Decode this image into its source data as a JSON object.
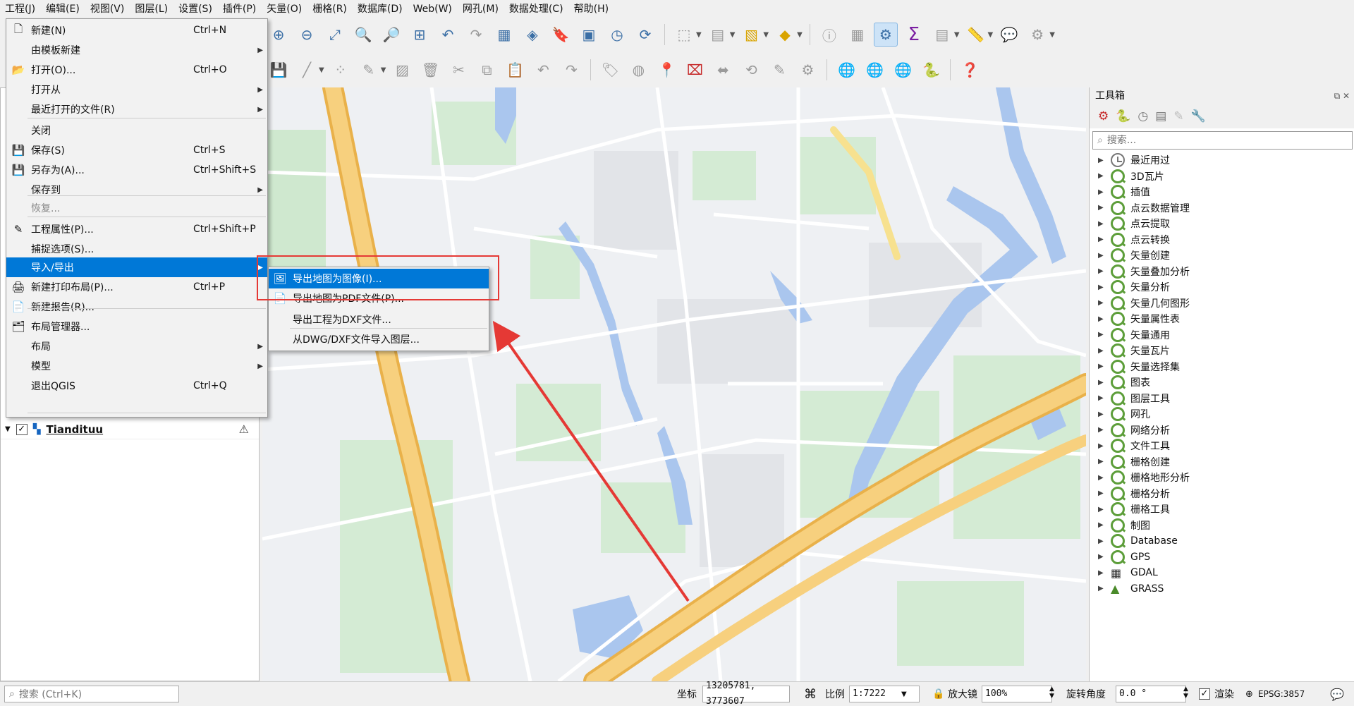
{
  "menubar": [
    {
      "label": "工程(J)",
      "active": true
    },
    {
      "label": "编辑(E)"
    },
    {
      "label": "视图(V)"
    },
    {
      "label": "图层(L)"
    },
    {
      "label": "设置(S)"
    },
    {
      "label": "插件(P)"
    },
    {
      "label": "矢量(O)"
    },
    {
      "label": "栅格(R)"
    },
    {
      "label": "数据库(D)"
    },
    {
      "label": "Web(W)"
    },
    {
      "label": "网孔(M)"
    },
    {
      "label": "数据处理(C)"
    },
    {
      "label": "帮助(H)"
    }
  ],
  "project_menu": {
    "items": [
      {
        "label": "新建(N)",
        "shortcut": "Ctrl+N",
        "icon": "new-file-icon"
      },
      {
        "label": "由模板新建",
        "submenu": true
      },
      {
        "label": "打开(O)...",
        "shortcut": "Ctrl+O",
        "icon": "folder-icon"
      },
      {
        "label": "打开从",
        "submenu": true
      },
      {
        "label": "最近打开的文件(R)",
        "submenu": true
      },
      {
        "label": "关闭"
      },
      {
        "label": "保存(S)",
        "shortcut": "Ctrl+S",
        "icon": "save-icon"
      },
      {
        "label": "另存为(A)...",
        "shortcut": "Ctrl+Shift+S",
        "icon": "save-as-icon"
      },
      {
        "label": "保存到",
        "submenu": true
      },
      {
        "label": "恢复...",
        "disabled": true
      },
      {
        "label": "工程属性(P)...",
        "shortcut": "Ctrl+Shift+P",
        "icon": "pencil-icon"
      },
      {
        "label": "捕捉选项(S)..."
      },
      {
        "label": "导入/导出",
        "submenu": true,
        "selected": true
      },
      {
        "label": "新建打印布局(P)...",
        "shortcut": "Ctrl+P",
        "icon": "print-layout-icon"
      },
      {
        "label": "新建报告(R)...",
        "icon": "report-icon"
      },
      {
        "label": "布局管理器...",
        "icon": "layout-manager-icon"
      },
      {
        "label": "布局",
        "submenu": true
      },
      {
        "label": "模型",
        "submenu": true
      },
      {
        "label": "退出QGIS",
        "shortcut": "Ctrl+Q"
      }
    ]
  },
  "export_submenu": {
    "items": [
      {
        "label": "导出地图为图像(I)...",
        "icon": "export-image-icon"
      },
      {
        "label": "导出地图为PDF文件(P)...",
        "icon": "export-pdf-icon"
      },
      {
        "label": "导出工程为DXF文件..."
      },
      {
        "label": "从DWG/DXF文件导入图层..."
      }
    ]
  },
  "layers_panel": {
    "layer_name": "Tiandituu",
    "layer_visible": true
  },
  "toolbox": {
    "title": "工具箱",
    "search_placeholder": "搜索...",
    "items": [
      {
        "label": "最近用过",
        "icon": "clock-icon"
      },
      {
        "label": "3D瓦片"
      },
      {
        "label": "插值"
      },
      {
        "label": "点云数据管理"
      },
      {
        "label": "点云提取"
      },
      {
        "label": "点云转换"
      },
      {
        "label": "矢量创建"
      },
      {
        "label": "矢量叠加分析"
      },
      {
        "label": "矢量分析"
      },
      {
        "label": "矢量几何图形"
      },
      {
        "label": "矢量属性表"
      },
      {
        "label": "矢量通用"
      },
      {
        "label": "矢量瓦片"
      },
      {
        "label": "矢量选择集"
      },
      {
        "label": "图表"
      },
      {
        "label": "图层工具"
      },
      {
        "label": "网孔"
      },
      {
        "label": "网络分析"
      },
      {
        "label": "文件工具"
      },
      {
        "label": "栅格创建"
      },
      {
        "label": "栅格地形分析"
      },
      {
        "label": "栅格分析"
      },
      {
        "label": "栅格工具"
      },
      {
        "label": "制图"
      },
      {
        "label": "Database"
      },
      {
        "label": "GPS"
      },
      {
        "label": "GDAL",
        "icon": "gdal-icon"
      },
      {
        "label": "GRASS",
        "icon": "grass-icon"
      }
    ]
  },
  "statusbar": {
    "locator_placeholder": "搜索 (Ctrl+K)",
    "coord_label": "坐标",
    "coord_value": "13205781, 3773607",
    "scale_label": "比例",
    "scale_value": "1:7222",
    "magnifier_label": "放大镜",
    "magnifier_value": "100%",
    "rotation_label": "旋转角度",
    "rotation_value": "0.0 °",
    "render_label": "渲染",
    "crs": "EPSG:3857"
  },
  "colors": {
    "menu_highlight": "#0078d7",
    "annotation_red": "#e53935",
    "map_water": "#aac6ee",
    "map_park": "#cfe8cf",
    "map_highway": "#f7c96a"
  }
}
